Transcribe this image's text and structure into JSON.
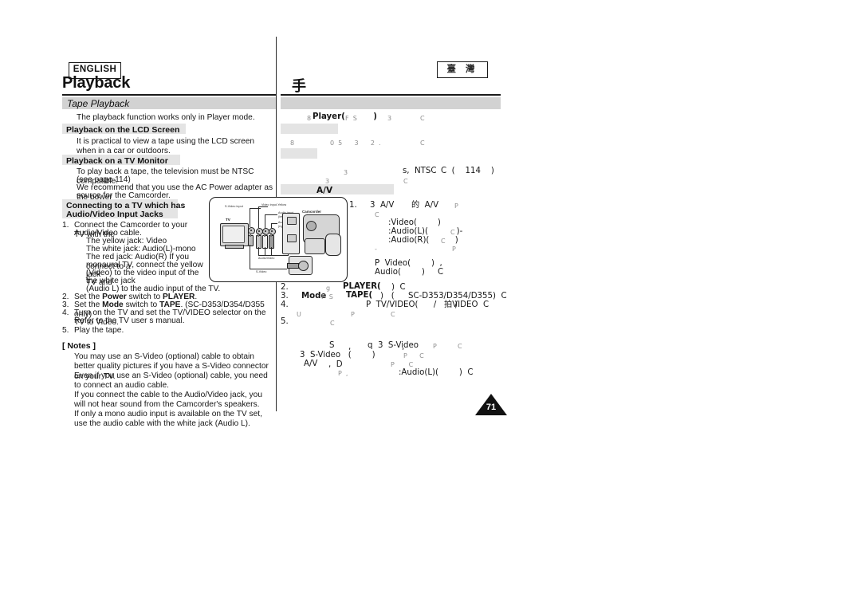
{
  "document": {
    "chapter_title_en": "Playback",
    "chapter_title_cn": "手",
    "language_badge": "ENGLISH",
    "locale_badge": "臺 灣",
    "page_number": "71"
  },
  "english": {
    "section_band": "Tape Playback",
    "intro": "The playback function works only in Player mode.",
    "lcd": {
      "heading": "Playback on the LCD Screen",
      "body": "It is practical to view a tape using the LCD screen when in a car or outdoors."
    },
    "tv_monitor": {
      "heading": "Playback on a TV Monitor",
      "line1": "To play back a tape, the television must be NTSC compatible.",
      "line2": "(see page 114)",
      "line3": "We recommend that you use the AC Power adapter as the power",
      "line4": "source for the Camcorder."
    },
    "connecting": {
      "heading_line1": "Connecting to a TV which has",
      "heading_line2": "Audio/Video Input Jacks",
      "steps": [
        {
          "number": "1.",
          "lines": [
            "Connect the Camcorder to your TV with the",
            "Audio/Video cable."
          ],
          "sub": [
            "The yellow jack: Video",
            "The white jack: Audio(L)-mono",
            "The red jack: Audio(R) If you connect to a",
            "monaural TV, connect the yellow jack",
            "(Video) to the video input of the TV and",
            "the white jack",
            "(Audio L) to the audio input of the TV."
          ]
        },
        {
          "number": "2.",
          "pre": "Set the ",
          "bold1": "Power",
          "mid": " switch to ",
          "bold2": "PLAYER",
          "post": "."
        },
        {
          "number": "3.",
          "pre": "Set the ",
          "bold1": "Mode",
          "mid": " switch to ",
          "bold2": "TAPE",
          "post": ". (SC-D353/D354/D355 only)"
        },
        {
          "number": "4.",
          "lines": [
            "Turn on the TV and set the TV/VIDEO selector on the TV to Video.",
            "Refer to the TV user s manual."
          ]
        },
        {
          "number": "5.",
          "lines": [
            "Play the tape."
          ]
        }
      ]
    },
    "notes": {
      "title": "[ Notes ]",
      "items": [
        "You may use an S-Video (optional) cable to obtain better quality pictures if you have a S-Video connector on your TV.",
        "Even if you use an S-Video (optional) cable, you need to connect an audio cable.",
        "If you connect the cable to the Audio/Video jack, you will not hear sound from the Camcorder's speakers.",
        "If only a mono audio input is available on the TV set, use the audio cable with the white jack (Audio L)."
      ]
    }
  },
  "chinese": {
    "intro_fragments": "Player(          )",
    "intro_marks_a": "8",
    "intro_marks_b": "F  S",
    "intro_marks_c": "3",
    "intro_marks_d": "C",
    "lcd_fragments_a": "8",
    "lcd_fragments_b": "0  5      3      2  .",
    "lcd_fragments_c": "C",
    "tv_line1_a": "3",
    "tv_line1_b": "s,  NTSC",
    "tv_line1_c": "C  (    114    )",
    "tv_line2": "C",
    "av_band": "A/V",
    "step1_number": "1.",
    "step1_a": "3  A/V",
    "step1_b": "的  A/V",
    "step1_c": "P",
    "step1_d": "C",
    "jack_video": ":Video(        )",
    "jack_audio_l": ":Audio(L)(           )-",
    "jack_audio_r": ":Audio(R)(          )",
    "jack_mark_c": "C",
    "jack_dash": "-",
    "jack_mark_p": "P",
    "mono_line1": "P  Video(        )  ,",
    "mono_line2": "Audio(        )     C",
    "step2_number": "2.",
    "step2_mark": "g",
    "step2_bold": "PLAYER(",
    "step2_tail": ")  C",
    "step3_number": "3.",
    "step3_mode": "Mode",
    "step3_marks": "F  S",
    "step3_bold": "TAPE(",
    "step3_mid": ")   (",
    "step3_model": "SC-D353/D354/D355)  C",
    "step4_number": "4.",
    "step4_a": "P  TV/VIDEO(      /       )",
    "step4_b": "拍VIDEO  C",
    "step4_c": "U",
    "step4_d": "P",
    "step4_e": "C",
    "step5_number": "5.",
    "step5_mark": "C",
    "note1_a": "S",
    "note1_b": ",",
    "note1_c": "q  3  S-Video",
    "note1_d": ",",
    "note1_e": "P",
    "note1_f": "C",
    "note2_a": "3  S-Video   (        )",
    "note2_b": "P      C",
    "note3_a": "A/V",
    "note3_b": ",  D",
    "note3_c": "P       C",
    "note4_a": "P  ,",
    "note4_b": ":Audio(L)(        )  C"
  },
  "diagram": {
    "labels": {
      "s_video_input": "S-Video input",
      "video_input": "Video input-Yellow",
      "audio_input_left_1": "Audio input",
      "audio_input_left_2": "(left)-White",
      "audio_input_right_1": "Audio input",
      "audio_input_right_2": "(right)-Red",
      "tv": "TV",
      "camcorder": "Camcorder",
      "audio_video_cable": "Audio/Video",
      "s_video_cable": "S-Video"
    }
  }
}
